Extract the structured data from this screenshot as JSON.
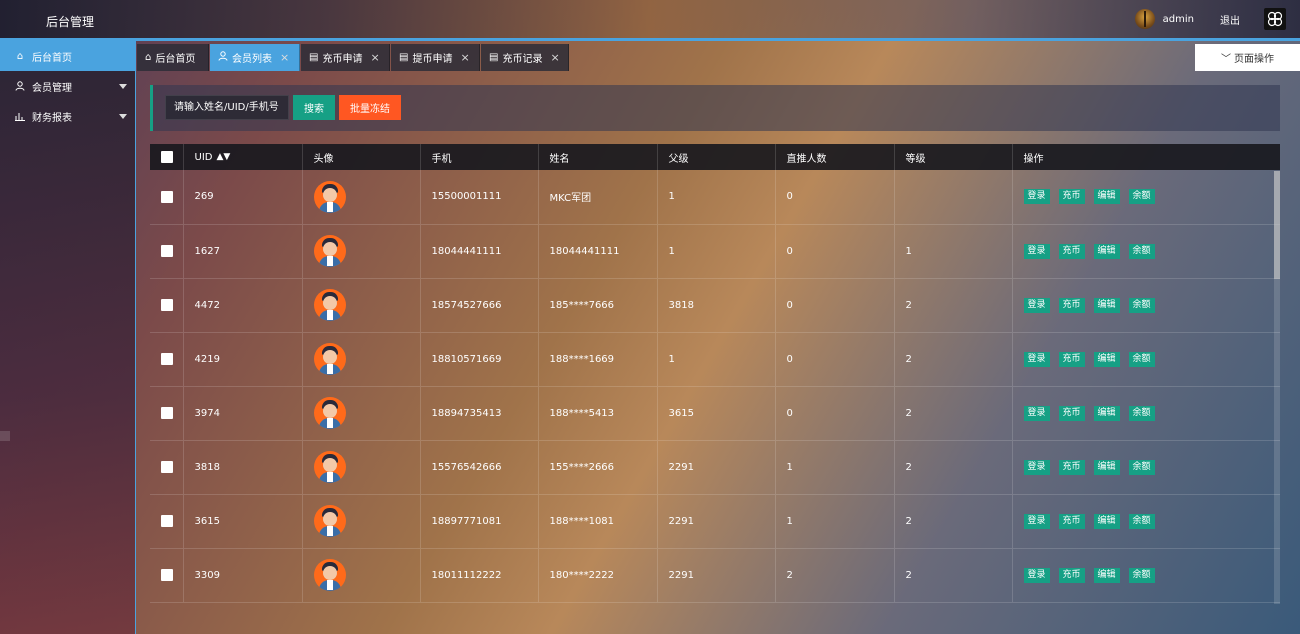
{
  "header": {
    "title": "后台管理",
    "user": "admin",
    "logout": "退出",
    "accent": "#4aa3df"
  },
  "sidebar": {
    "items": [
      {
        "label": "后台首页",
        "icon": "home-icon",
        "active": true
      },
      {
        "label": "会员管理",
        "icon": "user-icon",
        "expandable": true
      },
      {
        "label": "财务报表",
        "icon": "chart-icon",
        "expandable": true
      }
    ]
  },
  "tabs": [
    {
      "label": "后台首页",
      "icon": "home-icon",
      "closable": false
    },
    {
      "label": "会员列表",
      "icon": "user-icon",
      "closable": true,
      "active": true
    },
    {
      "label": "充币申请",
      "icon": "document-icon",
      "closable": true
    },
    {
      "label": "提币申请",
      "icon": "document-icon",
      "closable": true
    },
    {
      "label": "充币记录",
      "icon": "document-icon",
      "closable": true
    }
  ],
  "page_ops": "页面操作",
  "search": {
    "placeholder": "请输入姓名/UID/手机号",
    "search_label": "搜索",
    "freeze_label": "批量冻结"
  },
  "table": {
    "columns": [
      "UID",
      "头像",
      "手机",
      "姓名",
      "父级",
      "直推人数",
      "等级",
      "操作"
    ],
    "actions": [
      "登录",
      "充币",
      "编辑",
      "余额"
    ],
    "rows": [
      {
        "uid": "269",
        "phone": "15500001111",
        "name": "MKC军团",
        "parent": "1",
        "direct": "0",
        "level": ""
      },
      {
        "uid": "1627",
        "phone": "18044441111",
        "name": "18044441111",
        "parent": "1",
        "direct": "0",
        "level": "1"
      },
      {
        "uid": "4472",
        "phone": "18574527666",
        "name": "185****7666",
        "parent": "3818",
        "direct": "0",
        "level": "2"
      },
      {
        "uid": "4219",
        "phone": "18810571669",
        "name": "188****1669",
        "parent": "1",
        "direct": "0",
        "level": "2"
      },
      {
        "uid": "3974",
        "phone": "18894735413",
        "name": "188****5413",
        "parent": "3615",
        "direct": "0",
        "level": "2"
      },
      {
        "uid": "3818",
        "phone": "15576542666",
        "name": "155****2666",
        "parent": "2291",
        "direct": "1",
        "level": "2"
      },
      {
        "uid": "3615",
        "phone": "18897771081",
        "name": "188****1081",
        "parent": "2291",
        "direct": "1",
        "level": "2"
      },
      {
        "uid": "3309",
        "phone": "18011112222",
        "name": "180****2222",
        "parent": "2291",
        "direct": "2",
        "level": "2"
      }
    ]
  }
}
